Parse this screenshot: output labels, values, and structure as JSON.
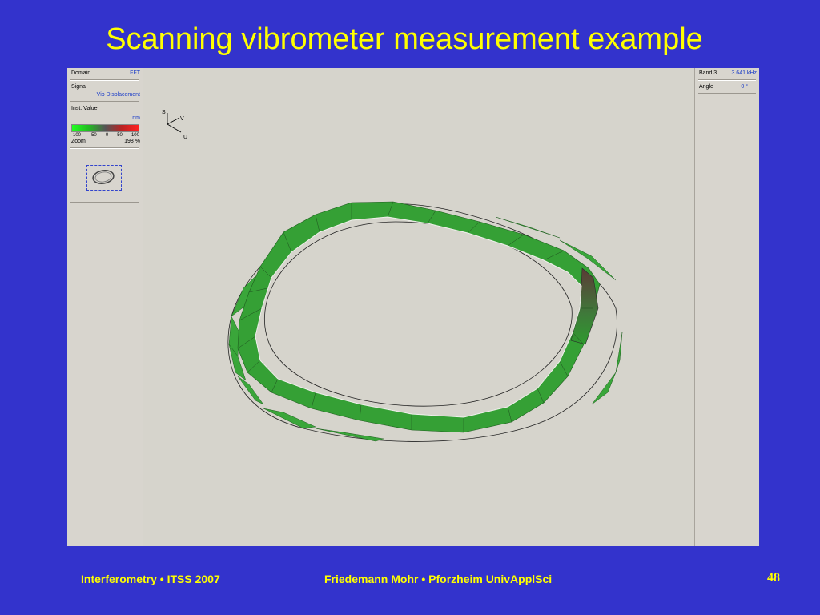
{
  "slide": {
    "title": "Scanning vibrometer measurement example",
    "footer_left": "Interferometry • ITSS 2007",
    "footer_center": "Friedemann Mohr • Pforzheim UnivApplSci",
    "page_number": "48"
  },
  "left_panel": {
    "domain_label": "Domain",
    "domain_value": "FFT",
    "signal_label": "Signal",
    "signal_value": "Vib Displacement",
    "inst_value_label": "Inst. Value",
    "unit": "nm",
    "scale_ticks": [
      "-100",
      "-50",
      "0",
      "50",
      "100"
    ],
    "zoom_label": "Zoom",
    "zoom_value": "198 %"
  },
  "right_panel": {
    "band_label": "Band 3",
    "band_value": "3.641 kHz",
    "angle_label": "Angle",
    "angle_value": "0 °"
  },
  "axes": {
    "s": "S",
    "v": "V",
    "u": "U"
  },
  "colors": {
    "background": "#3333cc",
    "title": "#ffff00",
    "mesh_green": "#33a833",
    "mesh_dark": "#6a4a44"
  }
}
